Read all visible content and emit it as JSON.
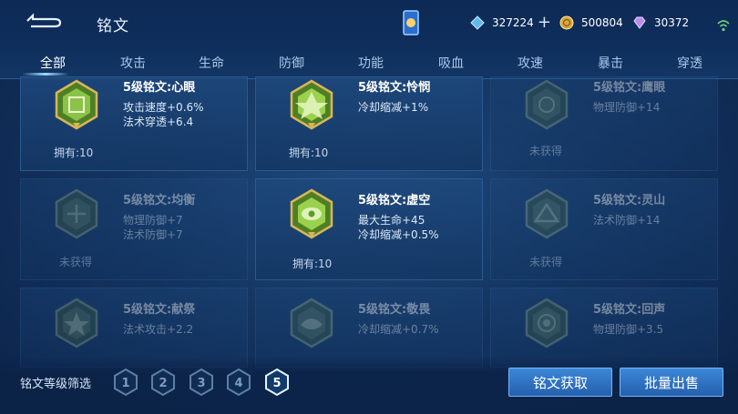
{
  "header": {
    "title": "铭文",
    "currencies": [
      {
        "icon": "diamond-coupon-icon",
        "value": "327224",
        "has_plus": true
      },
      {
        "icon": "gold-coin-icon",
        "value": "500804"
      },
      {
        "icon": "crystal-gem-icon",
        "value": "30372"
      }
    ]
  },
  "tabs": [
    "全部",
    "攻击",
    "生命",
    "防御",
    "功能",
    "吸血",
    "攻速",
    "暴击",
    "穿透"
  ],
  "active_tab": 0,
  "cards": [
    {
      "name": "5级铭文:心眼",
      "stats": [
        "攻击速度+0.6%",
        "法术穿透+6.4"
      ],
      "owned": "拥有:10",
      "obtained": true
    },
    {
      "name": "5级铭文:怜悯",
      "stats": [
        "冷却缩减+1%"
      ],
      "owned": "拥有:10",
      "obtained": true
    },
    {
      "name": "5级铭文:鹰眼",
      "stats": [
        "物理防御+14"
      ],
      "owned": "未获得",
      "obtained": false
    },
    {
      "name": "5级铭文:均衡",
      "stats": [
        "物理防御+7",
        "法术防御+7"
      ],
      "owned": "未获得",
      "obtained": false
    },
    {
      "name": "5级铭文:虚空",
      "stats": [
        "最大生命+45",
        "冷却缩减+0.5%"
      ],
      "owned": "拥有:10",
      "obtained": true
    },
    {
      "name": "5级铭文:灵山",
      "stats": [
        "法术防御+14"
      ],
      "owned": "未获得",
      "obtained": false
    },
    {
      "name": "5级铭文:献祭",
      "stats": [
        "法术攻击+2.2"
      ],
      "owned": "",
      "obtained": false
    },
    {
      "name": "5级铭文:敬畏",
      "stats": [
        "冷却缩减+0.7%"
      ],
      "owned": "",
      "obtained": false
    },
    {
      "name": "5级铭文:回声",
      "stats": [
        "物理防御+3.5"
      ],
      "owned": "",
      "obtained": false
    }
  ],
  "filter": {
    "label": "铭文等级筛选",
    "levels": [
      "1",
      "2",
      "3",
      "4",
      "5"
    ],
    "selected": "5"
  },
  "buttons": {
    "acquire": "铭文获取",
    "bulk_sell": "批量出售"
  },
  "colors": {
    "accent_blue": "#3c87d6",
    "emblem_green": "#8bc34a",
    "emblem_gold": "#c9a24a"
  }
}
